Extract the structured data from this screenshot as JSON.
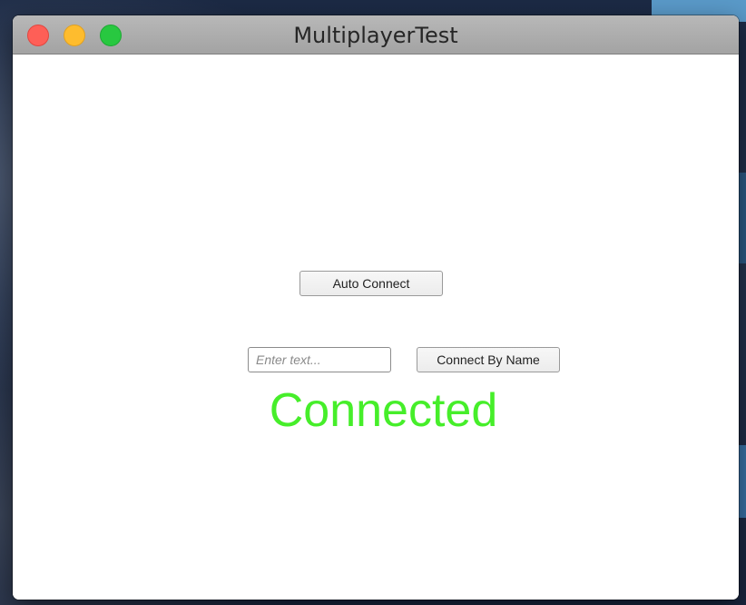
{
  "window": {
    "title": "MultiplayerTest"
  },
  "main": {
    "auto_connect_label": "Auto Connect",
    "name_input": {
      "value": "",
      "placeholder": "Enter text..."
    },
    "connect_by_name_label": "Connect By Name",
    "status_text": "Connected"
  },
  "colors": {
    "status": "#46ee2a",
    "close_button": "#fe5f57",
    "minimize_button": "#febc2e",
    "zoom_button": "#28c840"
  }
}
